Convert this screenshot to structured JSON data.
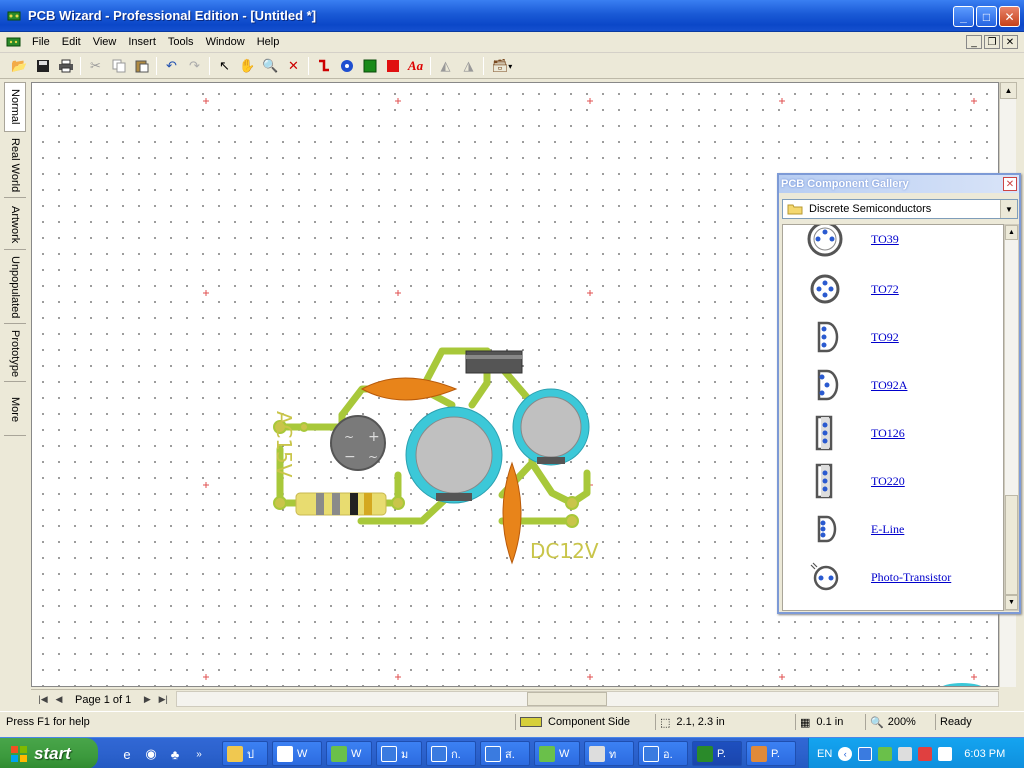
{
  "window": {
    "title": "PCB Wizard - Professional Edition - [Untitled *]"
  },
  "menu": [
    "File",
    "Edit",
    "View",
    "Insert",
    "Tools",
    "Window",
    "Help"
  ],
  "toolbar_icons": [
    "open-icon",
    "save-icon",
    "print-icon",
    "cut-icon",
    "copy-icon",
    "paste-icon",
    "undo-icon",
    "redo-icon",
    "select-arrow-icon",
    "hand-icon",
    "zoom-icon",
    "delete-icon",
    "track-icon",
    "pad-icon",
    "green-rect-icon",
    "red-rect-icon",
    "text-icon",
    "flip-icon",
    "rotate-icon",
    "component-icon"
  ],
  "left_tabs": [
    "Normal",
    "Real World",
    "Artwork",
    "Unpopulated",
    "Prototype",
    "More"
  ],
  "canvas": {
    "label_ac": "AC15V",
    "label_dc": "DC12V",
    "colors": {
      "track": "#a8c83a",
      "pad": "#c9c54a",
      "cap_blue": "#3cc8d8",
      "cap_orange": "#e8841a",
      "regulator": "#555555"
    }
  },
  "pagebar": {
    "page_label": "Page 1 of 1"
  },
  "status": {
    "help": "Press F1 for help",
    "layer": "Component Side",
    "coords": "2.1, 2.3 in",
    "grid": "0.1 in",
    "zoom": "200%",
    "state": "Ready"
  },
  "gallery": {
    "title": "PCB Component Gallery",
    "category": "Discrete Semiconductors",
    "items": [
      "TO39",
      "TO72",
      "TO92",
      "TO92A",
      "TO126",
      "TO220",
      "E-Line",
      "Photo-Transistor"
    ]
  },
  "taskbar": {
    "start_label": "start",
    "tasks": [
      "ป",
      "W",
      "W",
      "ม",
      "ก.",
      "ส.",
      "W",
      "ท",
      "อ.",
      "P.",
      "P."
    ],
    "language": "EN",
    "clock": "6:03 PM"
  }
}
